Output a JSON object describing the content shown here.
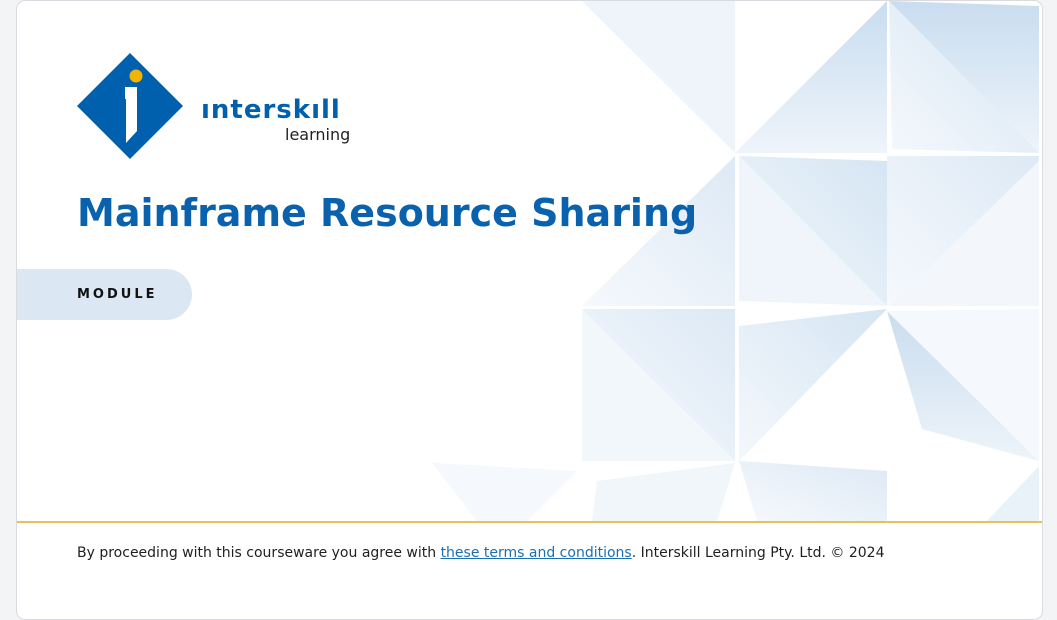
{
  "logo": {
    "word": "ınterskıll",
    "sub": "learning",
    "icon": "interskill-diamond-logo"
  },
  "title": "Mainframe Resource Sharing",
  "badge": "MODULE",
  "footer": {
    "prefix": "By proceeding with this courseware you agree with ",
    "link": "these terms and conditions",
    "suffix": ". Interskill Learning Pty. Ltd. © 2024"
  },
  "colors": {
    "brand": "#0060ad",
    "accent_dot": "#f2b400",
    "pill": "#dbe7f3",
    "divider": "#e9c15a",
    "link": "#1a6fb3",
    "text": "#111111"
  }
}
